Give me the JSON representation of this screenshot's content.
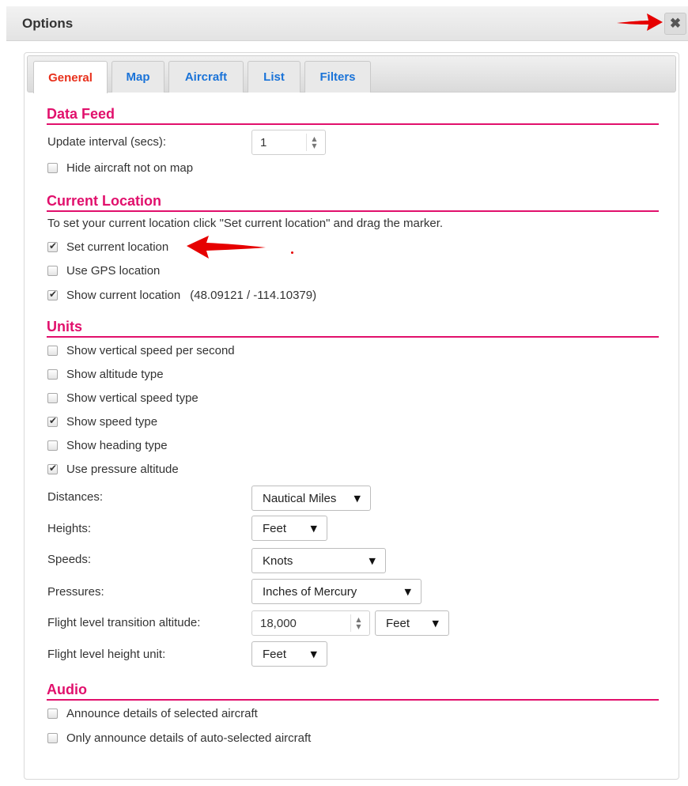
{
  "window": {
    "title": "Options",
    "close_icon": "✖"
  },
  "tabs": [
    "General",
    "Map",
    "Aircraft",
    "List",
    "Filters"
  ],
  "data_feed": {
    "heading": "Data Feed",
    "update_interval_label": "Update interval (secs):",
    "update_interval_value": "1",
    "hide_aircraft_label": "Hide aircraft not on map",
    "hide_aircraft_checked": false
  },
  "current_location": {
    "heading": "Current Location",
    "instructions": "To set your current location click \"Set current location\" and drag the marker.",
    "set_location_label": "Set current location",
    "set_location_checked": true,
    "use_gps_label": "Use GPS location",
    "use_gps_checked": false,
    "show_location_label": "Show current location",
    "show_location_checked": true,
    "coordinates": "(48.09121 / -114.10379)"
  },
  "units": {
    "heading": "Units",
    "checkboxes": [
      {
        "label": "Show vertical speed per second",
        "checked": false
      },
      {
        "label": "Show altitude type",
        "checked": false
      },
      {
        "label": "Show vertical speed type",
        "checked": false
      },
      {
        "label": "Show speed type",
        "checked": true
      },
      {
        "label": "Show heading type",
        "checked": false
      },
      {
        "label": "Use pressure altitude",
        "checked": true
      }
    ],
    "distances_label": "Distances:",
    "distances_value": "Nautical Miles",
    "heights_label": "Heights:",
    "heights_value": "Feet",
    "speeds_label": "Speeds:",
    "speeds_value": "Knots",
    "pressures_label": "Pressures:",
    "pressures_value": "Inches of Mercury",
    "fl_transition_label": "Flight level transition altitude:",
    "fl_transition_value": "18,000",
    "fl_transition_unit": "Feet",
    "fl_height_unit_label": "Flight level height unit:",
    "fl_height_unit_value": "Feet"
  },
  "audio": {
    "heading": "Audio",
    "checkboxes": [
      {
        "label": "Announce details of selected aircraft",
        "checked": false
      },
      {
        "label": "Only announce details of auto-selected aircraft",
        "checked": false
      }
    ]
  },
  "colors": {
    "accent": "#e1106c",
    "tab_active": "#e8301c",
    "tab_link": "#1a73d8",
    "annotation_arrow": "#e60000"
  },
  "icons": {
    "checkbox_check": "check-mark",
    "select_caret": "triangle-down",
    "spinner": "up-down-arrows",
    "close": "close-x"
  }
}
